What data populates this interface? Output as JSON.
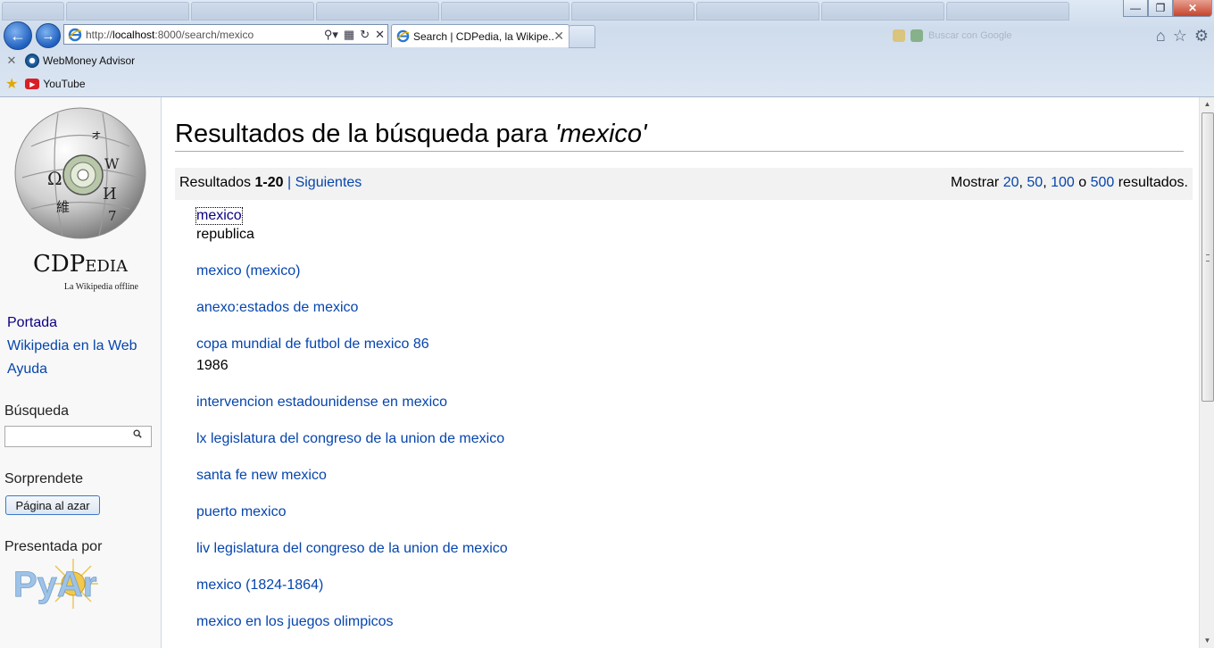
{
  "browser": {
    "address_prefix": "http://",
    "address_host": "localhost",
    "address_rest": ":8000/search/mexico",
    "tab_title": "Search | CDPedia, la Wikipe...",
    "search_placeholder": "Buscar con Google",
    "favorites": [
      {
        "label": "WebMoney Advisor",
        "icon": "webmoney-icon"
      },
      {
        "label": "YouTube",
        "icon": "youtube-icon"
      }
    ]
  },
  "sidebar": {
    "logo_name": "CDPedia",
    "logo_sub": "La Wikipedia offline",
    "nav": [
      {
        "label": "Portada"
      },
      {
        "label": "Wikipedia en la Web"
      },
      {
        "label": "Ayuda"
      }
    ],
    "search_label": "Búsqueda",
    "surprise_label": "Sorprendete",
    "random_button": "Página al azar",
    "presented_label": "Presentada por",
    "sponsor_logo": "PyAr"
  },
  "main": {
    "title_prefix": "Resultados de la búsqueda para ",
    "title_query": "'mexico'",
    "results_label": "Resultados ",
    "results_range": "1-20",
    "results_sep": " | ",
    "next_label": "Siguientes",
    "show_label": "Mostrar ",
    "show_options": [
      "20",
      "50",
      "100",
      "500"
    ],
    "show_or": " o ",
    "show_suffix": " resultados.",
    "results": [
      {
        "title": "mexico",
        "snippet": "republica"
      },
      {
        "title": "mexico (mexico)",
        "snippet": ""
      },
      {
        "title": "anexo:estados de mexico",
        "snippet": ""
      },
      {
        "title": "copa mundial de futbol de mexico 86",
        "snippet": "1986"
      },
      {
        "title": "intervencion estadounidense en mexico",
        "snippet": ""
      },
      {
        "title": "lx legislatura del congreso de la union de mexico",
        "snippet": ""
      },
      {
        "title": "santa fe new mexico",
        "snippet": ""
      },
      {
        "title": "puerto mexico",
        "snippet": ""
      },
      {
        "title": "liv legislatura del congreso de la union de mexico",
        "snippet": ""
      },
      {
        "title": "mexico (1824-1864)",
        "snippet": ""
      },
      {
        "title": "mexico en los juegos olimpicos",
        "snippet": ""
      }
    ]
  },
  "colors": {
    "link": "#0645ad",
    "visited_link": "#0b0080",
    "sidebar_bg": "#f8f8f8",
    "results_bar_bg": "#f2f2f2"
  }
}
